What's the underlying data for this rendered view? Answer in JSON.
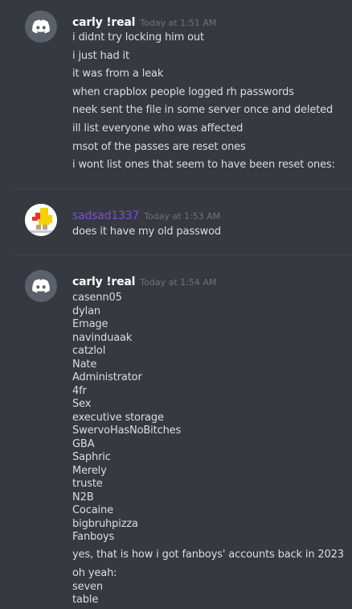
{
  "messages": [
    {
      "username": "carly !real",
      "timestamp": "Today at 1:51 AM",
      "lines": [
        "i didnt try locking him out",
        "i just had it",
        "it was from a leak",
        "when crapblox people logged rh passwords",
        "neek sent the file in some server once and deleted",
        "ill list everyone who was affected",
        "msot of the passes are reset ones",
        "i wont list ones that seem to have been reset ones:"
      ]
    },
    {
      "username": "sadsad1337",
      "timestamp": "Today at 1:53 AM",
      "lines": [
        "does it have my old passwod"
      ]
    },
    {
      "username": "carly !real",
      "timestamp": "Today at 1:54 AM",
      "list": [
        "casenn05",
        "dylan",
        "Emage",
        "navinduaak",
        "catzlol",
        "Nate",
        "Administrator",
        "4fr",
        "Sex",
        "executive storage",
        "SwervoHasNoBitches",
        "GBA",
        "Saphric",
        "Merely",
        "truste",
        "N2B",
        "Cocaine",
        "bigbruhpizza",
        "Fanboys"
      ],
      "after": "yes, that is how i got fanboys' accounts back in 2023",
      "tail": [
        "oh yeah:",
        "seven",
        "table"
      ]
    }
  ],
  "colors": {
    "background": "#36393f",
    "text": "#dcddde",
    "username": "#ffffff",
    "username_alt": "#7b4fd6",
    "timestamp": "#6e7279"
  },
  "icons": {
    "avatar_1": "discord-logo-icon",
    "avatar_2": "roblox-avatar-icon",
    "avatar_3": "discord-logo-icon"
  }
}
